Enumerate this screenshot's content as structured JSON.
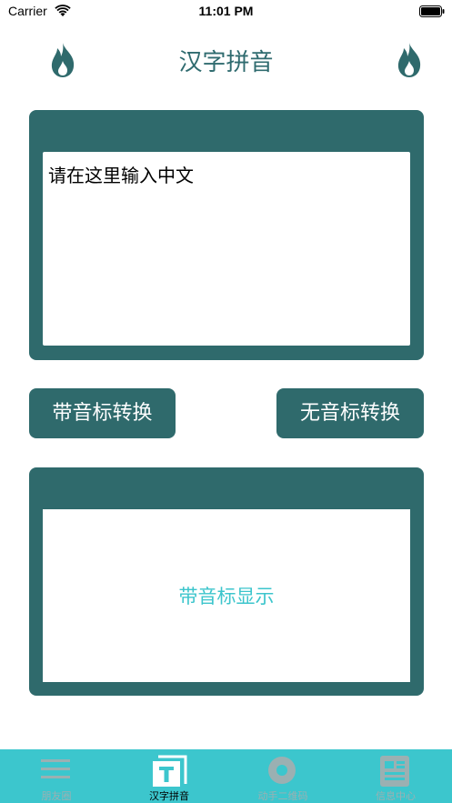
{
  "status_bar": {
    "carrier": "Carrier",
    "time": "11:01 PM"
  },
  "header": {
    "title": "汉字拼音",
    "left_icon": "flame-icon",
    "right_icon": "flame-icon"
  },
  "input": {
    "placeholder": "请在这里输入中文"
  },
  "buttons": {
    "with_tone": "带音标转换",
    "without_tone": "无音标转换"
  },
  "output": {
    "text": "带音标显示"
  },
  "tabs": [
    {
      "label": "朋友圈",
      "icon": "list-icon",
      "active": false
    },
    {
      "label": "汉字拼音",
      "icon": "text-t-icon",
      "active": true
    },
    {
      "label": "动手二维码",
      "icon": "disc-icon",
      "active": false
    },
    {
      "label": "信息中心",
      "icon": "news-icon",
      "active": false
    }
  ],
  "colors": {
    "primary": "#2f6a6c",
    "accent": "#3cc6cd",
    "title": "#2f6b6f"
  }
}
